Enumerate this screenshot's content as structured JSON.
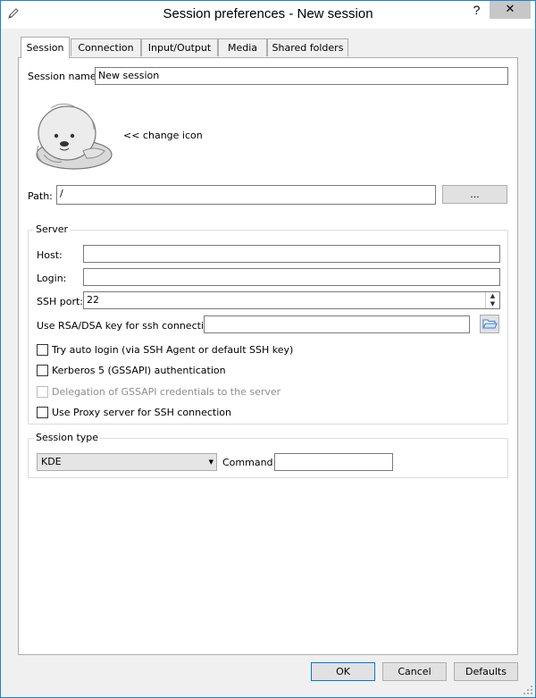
{
  "window": {
    "title": "Session preferences - New session",
    "help_label": "?",
    "close_label": "✕"
  },
  "tabs": [
    {
      "label": "Session",
      "active": true
    },
    {
      "label": "Connection",
      "active": false
    },
    {
      "label": "Input/Output",
      "active": false
    },
    {
      "label": "Media",
      "active": false
    },
    {
      "label": "Shared folders",
      "active": false
    }
  ],
  "session": {
    "name_label": "Session name:",
    "name_value": "New session",
    "change_icon_label": "<< change icon",
    "path_label": "Path:",
    "path_value": "/",
    "browse_label": "..."
  },
  "server": {
    "group_title": "Server",
    "host_label": "Host:",
    "host_value": "",
    "login_label": "Login:",
    "login_value": "",
    "ssh_port_label": "SSH port:",
    "ssh_port_value": "22",
    "key_label": "Use RSA/DSA key for ssh connection:",
    "key_value": "",
    "options": [
      {
        "label": "Try auto login (via SSH Agent or default SSH key)",
        "checked": false,
        "enabled": true
      },
      {
        "label": "Kerberos 5 (GSSAPI) authentication",
        "checked": false,
        "enabled": true
      },
      {
        "label": "Delegation of GSSAPI credentials to the server",
        "checked": false,
        "enabled": false
      },
      {
        "label": "Use Proxy server for SSH connection",
        "checked": false,
        "enabled": true
      }
    ]
  },
  "session_type": {
    "group_title": "Session type",
    "selected": "KDE",
    "command_label": "Command:",
    "command_value": ""
  },
  "footer": {
    "ok_label": "OK",
    "cancel_label": "Cancel",
    "defaults_label": "Defaults"
  },
  "colors": {
    "window_border": "#1883d7",
    "default_button_border": "#0078d7",
    "folder_icon": "#3b7bd4"
  }
}
